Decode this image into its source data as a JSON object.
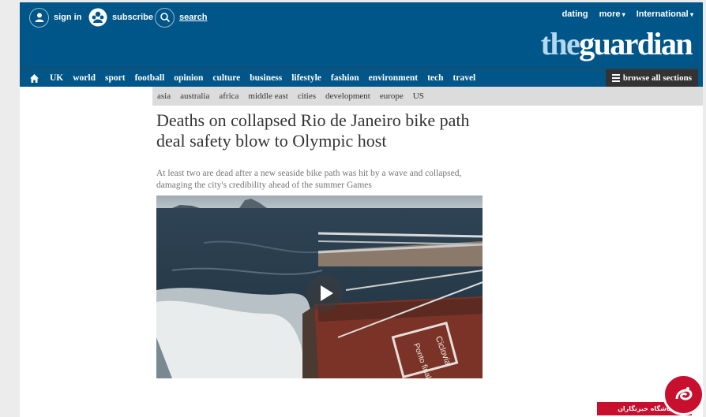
{
  "topbar": {
    "sign_in": "sign in",
    "subscribe": "subscribe",
    "search": "search",
    "dating": "dating",
    "more": "more",
    "edition": "International"
  },
  "logo": {
    "the": "the",
    "guardian": "guardian"
  },
  "nav": {
    "items": [
      "UK",
      "world",
      "sport",
      "football",
      "opinion",
      "culture",
      "business",
      "lifestyle",
      "fashion",
      "environment",
      "tech",
      "travel"
    ],
    "browse_all": "browse all sections"
  },
  "subnav": {
    "items": [
      "asia",
      "australia",
      "africa",
      "middle east",
      "cities",
      "development",
      "europe",
      "US"
    ]
  },
  "article": {
    "headline": "Deaths on collapsed Rio de Janeiro bike path deal safety blow to Olympic host",
    "standfirst": "At least two are dead after a new seaside bike path was hit by a wave and collapsed, damaging the city's credibility ahead of the summer Games",
    "video_sign_1": "Ponto final",
    "video_sign_2": "Ciclovia"
  },
  "watermark": {
    "text": "باشگاه خبرنگاران"
  },
  "colors": {
    "brand_blue": "#005689",
    "logo_the": "#b4d8ee",
    "watermark_red": "#c8102e"
  }
}
